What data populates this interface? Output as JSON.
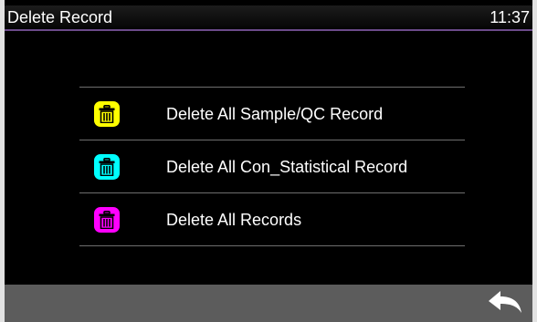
{
  "header": {
    "title": "Delete Record",
    "time": "11:37"
  },
  "menu": {
    "items": [
      {
        "label": "Delete All Sample/QC Record",
        "icon": "trash-icon",
        "color": "#ffff00"
      },
      {
        "label": "Delete All Con_Statistical Record",
        "icon": "trash-icon",
        "color": "#00ffff"
      },
      {
        "label": "Delete All Records",
        "icon": "trash-icon",
        "color": "#ff00ff"
      }
    ]
  },
  "footer": {
    "back_icon": "back-arrow-icon"
  },
  "colors": {
    "background": "#000000",
    "footer": "#5c5c5c",
    "title_underline": "#6b4a8a"
  }
}
